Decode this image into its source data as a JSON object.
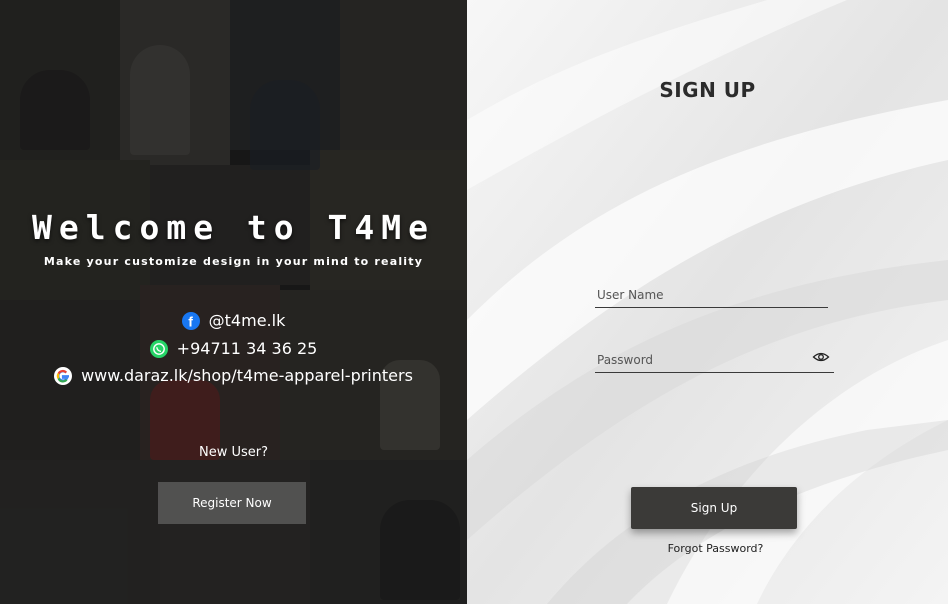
{
  "left_panel": {
    "welcome_title": "Welcome to T4Me",
    "tagline": "Make your customize design in your mind to reality",
    "contacts": {
      "facebook": {
        "icon": "facebook-icon",
        "text": "@t4me.lk"
      },
      "whatsapp": {
        "icon": "whatsapp-icon",
        "text": "+94711 34 36 25"
      },
      "website": {
        "icon": "google-icon",
        "text": "www.daraz.lk/shop/t4me-apparel-printers"
      }
    },
    "new_user_label": "New User?",
    "register_button": "Register Now"
  },
  "right_panel": {
    "title": "SIGN UP",
    "username": {
      "placeholder": "User Name",
      "value": ""
    },
    "password": {
      "placeholder": "Password",
      "value": "",
      "toggle_icon": "eye-icon"
    },
    "signup_button": "Sign Up",
    "forgot_password": "Forgot Password?"
  },
  "colors": {
    "facebook": "#1877f2",
    "whatsapp": "#25d366",
    "button_dark": "#3b3a38"
  }
}
